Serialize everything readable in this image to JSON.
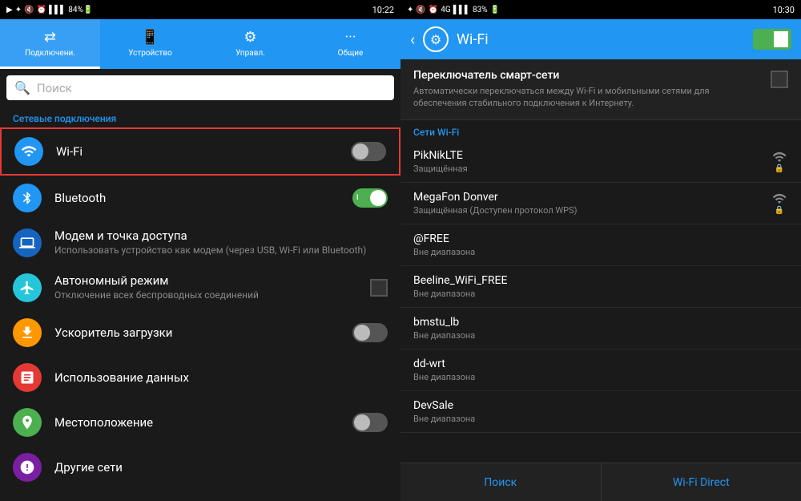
{
  "left": {
    "statusBar": {
      "left": [
        "▶",
        "✦",
        "🔇",
        "⏰",
        "📶",
        "84%",
        "🔋"
      ],
      "time": "10:22",
      "timeDisplay": "10:22"
    },
    "tabs": [
      {
        "id": "connections",
        "label": "Подключени.",
        "icon": "⇄",
        "active": true
      },
      {
        "id": "device",
        "label": "Устройство",
        "icon": "📱",
        "active": false
      },
      {
        "id": "controls",
        "label": "Управл.",
        "icon": "⚙",
        "active": false
      },
      {
        "id": "general",
        "label": "Общие",
        "icon": "···",
        "active": false
      }
    ],
    "searchPlaceholder": "Поиск",
    "sectionHeader": "Сетевые подключения",
    "items": [
      {
        "id": "wifi",
        "icon": "wifi",
        "iconBg": "icon-blue",
        "title": "Wi-Fi",
        "subtitle": "",
        "toggle": "off",
        "highlighted": true
      },
      {
        "id": "bluetooth",
        "icon": "bluetooth",
        "iconBg": "icon-blue",
        "title": "Bluetooth",
        "subtitle": "",
        "toggle": "on",
        "highlighted": false
      },
      {
        "id": "modem",
        "icon": "modem",
        "iconBg": "icon-blue2",
        "title": "Модем и точка доступа",
        "subtitle": "Использовать устройство как модем (через USB, Wi-Fi или Bluetooth)",
        "toggle": "none",
        "highlighted": false
      },
      {
        "id": "airplane",
        "icon": "airplane",
        "iconBg": "icon-teal",
        "title": "Автономный режим",
        "subtitle": "Отключение всех беспроводных соединений",
        "toggle": "checkbox",
        "highlighted": false
      },
      {
        "id": "download",
        "icon": "download",
        "iconBg": "icon-orange",
        "title": "Ускоритель загрузки",
        "subtitle": "",
        "toggle": "off",
        "highlighted": false
      },
      {
        "id": "datausage",
        "icon": "data",
        "iconBg": "icon-red",
        "title": "Использование данных",
        "subtitle": "",
        "toggle": "none",
        "highlighted": false
      },
      {
        "id": "location",
        "icon": "location",
        "iconBg": "icon-green",
        "title": "Местоположение",
        "subtitle": "",
        "toggle": "off",
        "highlighted": false
      },
      {
        "id": "other",
        "icon": "more",
        "iconBg": "icon-purple",
        "title": "Другие сети",
        "subtitle": "",
        "toggle": "none",
        "highlighted": false
      }
    ]
  },
  "right": {
    "statusBar": {
      "timeDisplay": "10:30",
      "batteryPercent": "83%"
    },
    "header": {
      "title": "Wi-Fi",
      "backLabel": "‹",
      "settingsGear": "⚙"
    },
    "smartSwitch": {
      "title": "Переключатель смарт-сети",
      "description": "Автоматически переключаться между Wi-Fi и мобильными сетями для обеспечения стабильного подключения к Интернету."
    },
    "wifiSectionLabel": "Сети Wi-Fi",
    "networks": [
      {
        "id": "piknik",
        "name": "PikNikLTE",
        "status": "Защищённая",
        "signal": "strong",
        "locked": true
      },
      {
        "id": "megafon",
        "name": "MegaFon Donver",
        "status": "Защищённая (Доступен протокол WPS)",
        "signal": "medium",
        "locked": true
      },
      {
        "id": "free",
        "name": "@FREE",
        "status": "Вне диапазона",
        "signal": "none",
        "locked": false
      },
      {
        "id": "beeline",
        "name": "Beeline_WiFi_FREE",
        "status": "Вне диапазона",
        "signal": "none",
        "locked": false
      },
      {
        "id": "bmstu",
        "name": "bmstu_lb",
        "status": "Вне диапазона",
        "signal": "none",
        "locked": false
      },
      {
        "id": "ddwrt",
        "name": "dd-wrt",
        "status": "Вне диапазона",
        "signal": "none",
        "locked": false
      },
      {
        "id": "devsale",
        "name": "DevSale",
        "status": "Вне диапазона",
        "signal": "none",
        "locked": false
      }
    ],
    "bottomButtons": [
      {
        "id": "search",
        "label": "Поиск"
      },
      {
        "id": "wifidirect",
        "label": "Wi-Fi Direct"
      }
    ]
  }
}
